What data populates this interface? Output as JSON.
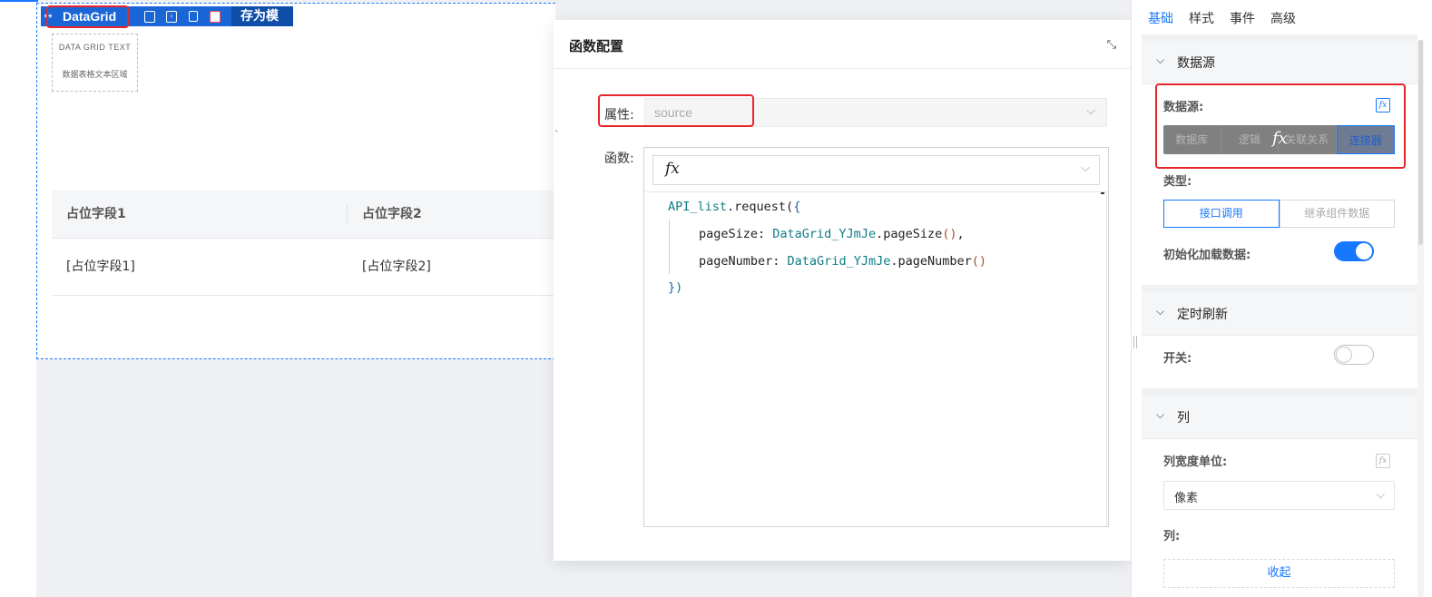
{
  "canvas": {
    "component_name": "DataGrid",
    "save_template_label": "存为模板",
    "text_area": {
      "title_en": "DATA GRID TEXT",
      "title_cn": "数据表格文本区域"
    },
    "table": {
      "headers": [
        "占位字段1",
        "占位字段2"
      ],
      "rows": [
        [
          "[占位字段1]",
          "[占位字段2]"
        ]
      ]
    },
    "toolbar_icons": [
      "move-icon",
      "document-icon",
      "terminal-icon",
      "copy-icon",
      "delete-icon"
    ]
  },
  "modal": {
    "title": "函数配置",
    "property_label": "属性:",
    "property_value": "source",
    "function_label": "函数:",
    "fx_symbol": "𝑓x",
    "code": {
      "line1_obj": "API_list",
      "line1_rest": ".request(",
      "line1_brace": "{",
      "line2_key": "pageSize: ",
      "line2_obj": "DataGrid_YJmJe",
      "line2_call": ".pageSize",
      "line2_paren": "()",
      "line2_end": ",",
      "line3_key": "pageNumber: ",
      "line3_obj": "DataGrid_YJmJe",
      "line3_call": ".pageNumber",
      "line3_paren": "()",
      "line4_brace": "}",
      "line4_paren": ")"
    }
  },
  "panel": {
    "tabs": [
      "基础",
      "样式",
      "事件",
      "高级"
    ],
    "active_tab": "基础",
    "sections": {
      "datasource": {
        "title": "数据源",
        "label": "数据源:",
        "options": [
          "数据库",
          "逻辑",
          "关联关系",
          "连接器"
        ],
        "active_option": "连接器",
        "type_label": "类型:",
        "type_options": [
          "接口调用",
          "继承组件数据"
        ],
        "active_type": "接口调用",
        "init_load_label": "初始化加载数据:",
        "init_load_on": true
      },
      "refresh": {
        "title": "定时刷新",
        "switch_label": "开关:",
        "switch_on": false
      },
      "columns": {
        "title": "列",
        "width_unit_label": "列宽度单位:",
        "width_unit_value": "像素",
        "columns_label": "列:",
        "collapse_label": "收起"
      }
    }
  },
  "colors": {
    "accent": "#1677ff",
    "highlight": "#e8262a",
    "toolbar": "#1b66d6"
  }
}
